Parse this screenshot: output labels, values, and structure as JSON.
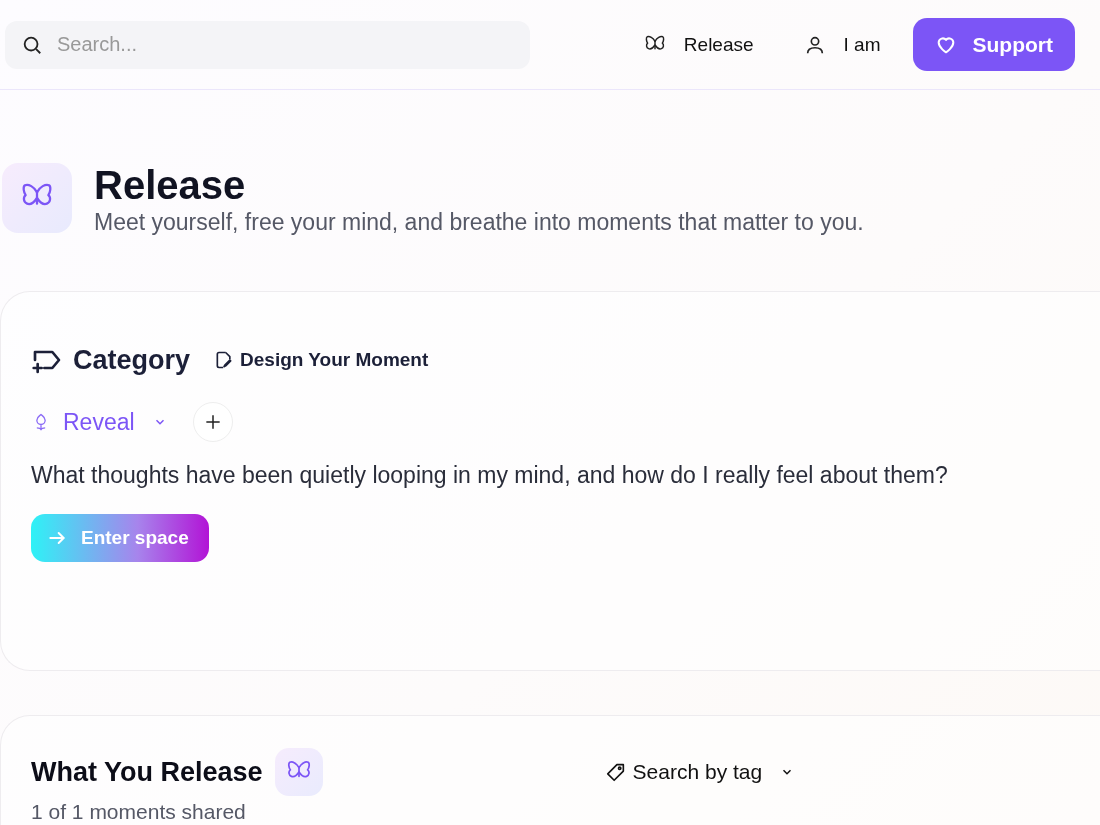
{
  "header": {
    "search": {
      "placeholder": "Search..."
    },
    "nav": [
      {
        "label": "Release",
        "kind": "butterfly"
      },
      {
        "label": "I am",
        "kind": "person"
      }
    ],
    "support_button": "Support"
  },
  "hero": {
    "title": "Release",
    "subtitle": "Meet yourself, free your mind, and breathe into moments that matter to you."
  },
  "moment_card": {
    "heading": "Category",
    "design_link": "Design Your Moment",
    "category": {
      "label": "Reveal"
    },
    "question": "What thoughts have been quietly looping in my mind, and how do I really feel about them?",
    "enter_button": "Enter space"
  },
  "release_card": {
    "title": "What You Release",
    "count": "1 of 1 moments shared",
    "tag_filter": "Search by tag"
  }
}
